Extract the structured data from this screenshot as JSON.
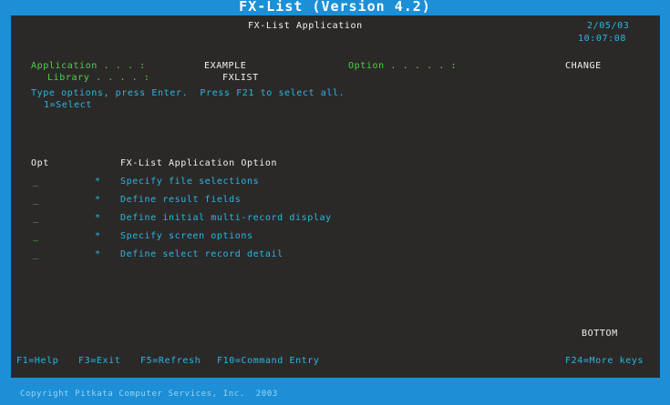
{
  "window": {
    "title": "FX-List (Version 4.2)"
  },
  "header": {
    "screen_title": "FX-List Application",
    "date": "2/05/03",
    "time": "10:07:08"
  },
  "fields": {
    "application_label": "Application . . . :",
    "application_value": "EXAMPLE",
    "library_label": "Library . . . . :",
    "library_value": "FXLIST",
    "option_label": "Option . . . . . :",
    "option_value": "CHANGE"
  },
  "instructions": {
    "line1": "Type options, press Enter.  Press F21 to select all.",
    "line2": "1=Select"
  },
  "list": {
    "col_opt": "Opt",
    "col_option": "FX-List Application Option",
    "rows": [
      {
        "opt": "_",
        "bullet": "*",
        "label": "Specify file selections"
      },
      {
        "opt": "_",
        "bullet": "*",
        "label": "Define result fields"
      },
      {
        "opt": "_",
        "bullet": "*",
        "label": "Define initial multi-record display"
      },
      {
        "opt": "_",
        "bullet": "*",
        "label": "Specify screen options"
      },
      {
        "opt": "_",
        "bullet": "*",
        "label": "Define select record detail"
      }
    ]
  },
  "status": {
    "position": "BOTTOM"
  },
  "function_keys": {
    "f1": "F1=Help",
    "f3": "F3=Exit",
    "f5": "F5=Refresh",
    "f10": "F10=Command Entry",
    "f24": "F24=More keys"
  },
  "footer": {
    "copyright": "Copyright Pitkata Computer Services, Inc.  2003"
  }
}
